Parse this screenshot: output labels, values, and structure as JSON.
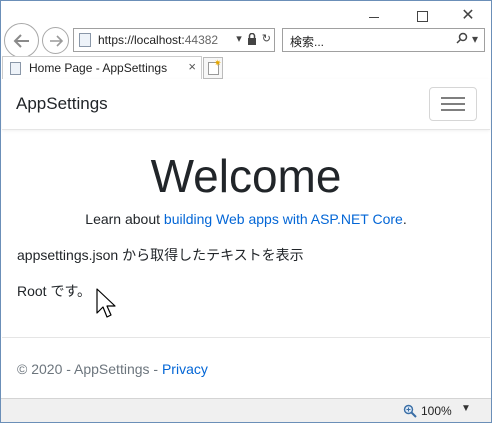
{
  "browser": {
    "address_url": "https://localhost:",
    "address_port": "44382",
    "search_placeholder": "検索...",
    "tab_title": "Home Page - AppSettings",
    "tab_close": "×",
    "zoom": "100%"
  },
  "navbar": {
    "brand": "AppSettings"
  },
  "main": {
    "heading": "Welcome",
    "learn_prefix": "Learn about ",
    "learn_link": "building Web apps with ASP.NET Core",
    "learn_suffix": ".",
    "line1": "appsettings.json から取得したテキストを表示",
    "line2": "Root です。"
  },
  "footer": {
    "copyright": "© 2020 - AppSettings - ",
    "privacy_link": "Privacy"
  },
  "colors": {
    "link": "#0366d6",
    "footer_text": "#6c757d"
  },
  "icons": [
    "back-arrow-icon",
    "forward-arrow-icon",
    "page-icon",
    "dropdown-icon",
    "lock-icon",
    "refresh-icon",
    "search-icon",
    "new-tab-icon",
    "zoom-icon",
    "hamburger-icon",
    "mouse-cursor"
  ]
}
